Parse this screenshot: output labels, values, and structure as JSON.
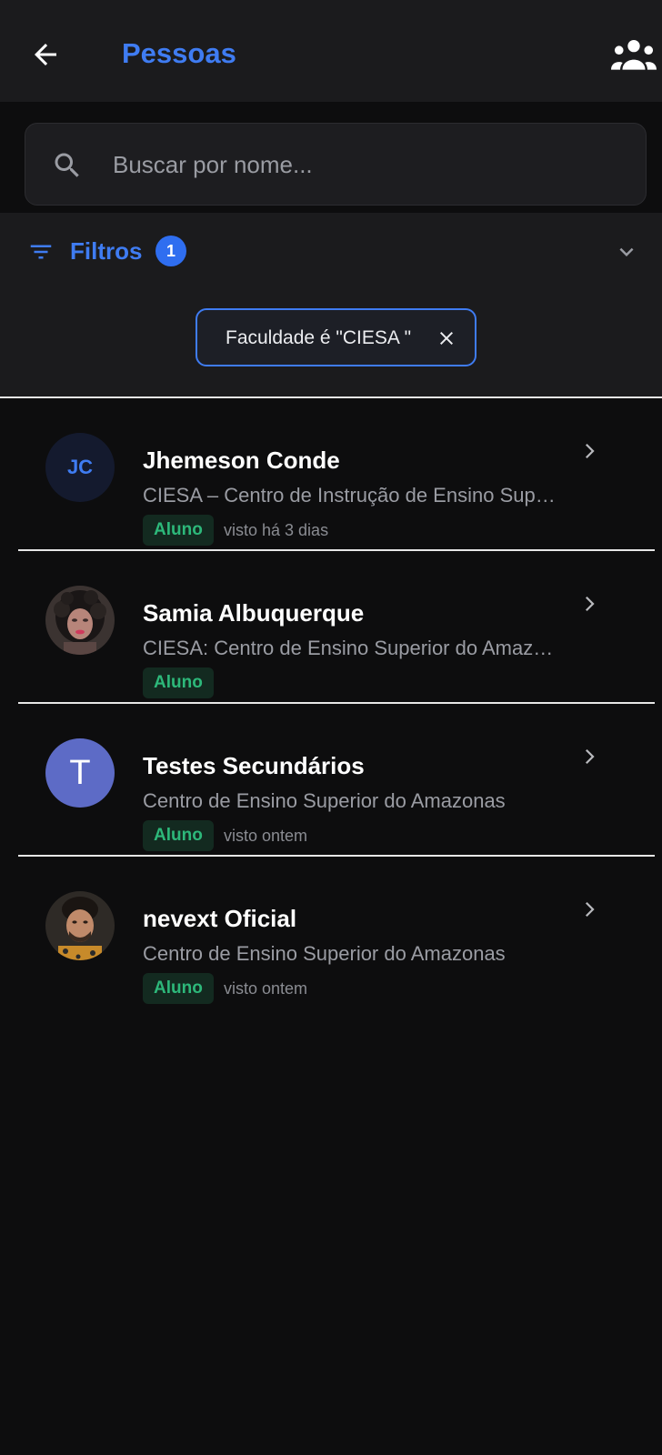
{
  "appbar": {
    "title": "Pessoas",
    "back_icon": "arrow-left-icon",
    "group_icon": "people-group-icon",
    "accent": "#3f7cf2"
  },
  "search": {
    "value": "",
    "placeholder": "Buscar por nome...",
    "icon": "search-icon"
  },
  "filters": {
    "label": "Filtros",
    "count": "1",
    "chip_label": "Faculdade é \"CIESA \"",
    "icon": "filter-icon",
    "toggle_icon": "chevron-down-icon"
  },
  "people": [
    {
      "name": "Jhemeson Conde",
      "school": "CIESA – Centro de Instrução de Ensino Superior do Amazonas",
      "role": "Aluno",
      "seen": "visto há 3 dias",
      "avatar": "JC",
      "avatar_type": "initials"
    },
    {
      "name": "Samia Albuquerque",
      "school": "CIESA: Centro de Ensino Superior do Amazonas",
      "role": "Aluno",
      "seen": "",
      "avatar": "photo",
      "avatar_type": "photo"
    },
    {
      "name": "Testes Secundários",
      "school": "Centro de Ensino Superior do Amazonas",
      "role": "Aluno",
      "seen": "visto ontem",
      "avatar": "T",
      "avatar_type": "letter"
    },
    {
      "name": "nevext Oficial",
      "school": "Centro de Ensino Superior do Amazonas",
      "role": "Aluno",
      "seen": "visto ontem",
      "avatar": "photo",
      "avatar_type": "photo"
    }
  ],
  "colors": {
    "background": "#0d0d0e",
    "surface": "#1b1b1d",
    "badge_bg": "#132a20",
    "badge_text": "#2db87a"
  }
}
